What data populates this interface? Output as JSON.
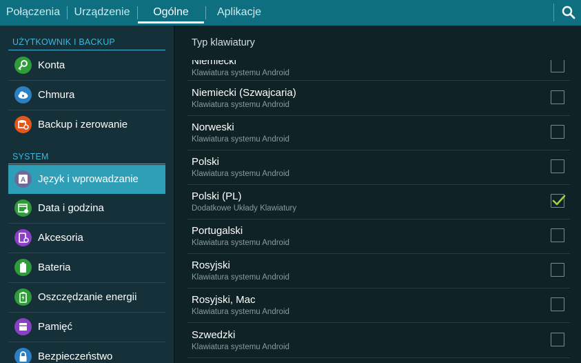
{
  "tabs": [
    "Połączenia",
    "Urządzenie",
    "Ogólne",
    "Aplikacje"
  ],
  "active_tab": "Ogólne",
  "sidebar": {
    "sections": [
      {
        "header": "UŻYTKOWNIK I BACKUP",
        "items": [
          {
            "label": "Konta",
            "icon": "key-icon",
            "color": "#2f9c3a"
          },
          {
            "label": "Chmura",
            "icon": "cloud-icon",
            "color": "#2c7fc2"
          },
          {
            "label": "Backup i zerowanie",
            "icon": "backup-icon",
            "color": "#e2581b"
          }
        ]
      },
      {
        "header": "SYSTEM",
        "items": [
          {
            "label": "Język i wprowadzanie",
            "icon": "keyboard-a-icon",
            "color": "#6d6a9a",
            "selected": true
          },
          {
            "label": "Data i godzina",
            "icon": "calendar-icon",
            "color": "#2f9c3a"
          },
          {
            "label": "Akcesoria",
            "icon": "accessory-icon",
            "color": "#8b3fc7"
          },
          {
            "label": "Bateria",
            "icon": "battery-icon",
            "color": "#2f9c3a"
          },
          {
            "label": "Oszczędzanie energii",
            "icon": "power-saving-icon",
            "color": "#2f9c3a"
          },
          {
            "label": "Pamięć",
            "icon": "storage-icon",
            "color": "#8b3fc7"
          },
          {
            "label": "Bezpieczeństwo",
            "icon": "lock-icon",
            "color": "#2c7fc2"
          }
        ]
      }
    ]
  },
  "main": {
    "title": "Typ klawiatury",
    "rows": [
      {
        "name": "Niemiecki",
        "sub": "Klawiatura systemu Android",
        "checked": false
      },
      {
        "name": "Niemiecki (Szwajcaria)",
        "sub": "Klawiatura systemu Android",
        "checked": false
      },
      {
        "name": "Norweski",
        "sub": "Klawiatura systemu Android",
        "checked": false
      },
      {
        "name": "Polski",
        "sub": "Klawiatura systemu Android",
        "checked": false
      },
      {
        "name": "Polski (PL)",
        "sub": "Dodatkowe Układy Klawiatury",
        "checked": true
      },
      {
        "name": "Portugalski",
        "sub": "Klawiatura systemu Android",
        "checked": false
      },
      {
        "name": "Rosyjski",
        "sub": "Klawiatura systemu Android",
        "checked": false
      },
      {
        "name": "Rosyjski, Mac",
        "sub": "Klawiatura systemu Android",
        "checked": false
      },
      {
        "name": "Szwedzki",
        "sub": "Klawiatura systemu Android",
        "checked": false
      }
    ]
  },
  "colors": {
    "topbar": "#0e6f80",
    "accent": "#3fb7d9",
    "selected": "#2f9fb7",
    "check": "#a6d13a"
  }
}
